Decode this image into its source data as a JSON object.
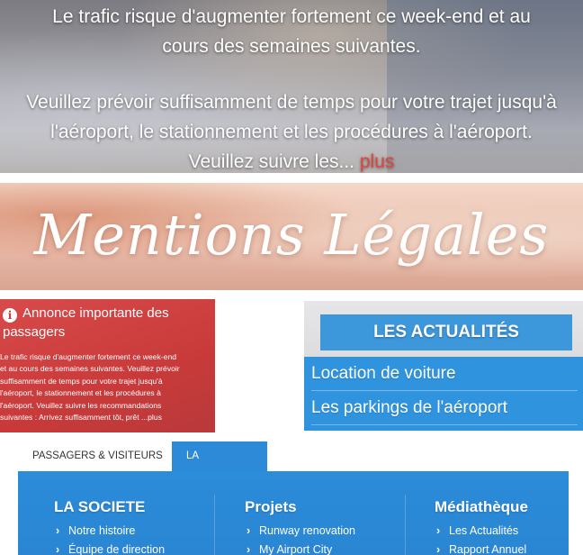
{
  "hero": {
    "line1": "Le trafic risque d'augmenter fortement ce week-end et au",
    "line2": "cours des semaines suivantes.",
    "line3": "Veuillez prévoir suffisamment de temps pour votre trajet jusqu'à",
    "line4": "l'aéroport, le stationnement et les procédures à l'aéroport.",
    "line5": "Veuillez suivre les...",
    "more_link": "plus"
  },
  "mentions": {
    "title": "Mentions Légales"
  },
  "notice": {
    "title_line1": "Annonce importante des",
    "title_line2": "passagers",
    "body": [
      "Le trafic risque d'augmenter fortement ce week-end",
      "et au cours des semaines suivantes. Veuillez prévoir",
      "suffisamment de temps pour votre trajet jusqu'à",
      "l'aéroport, le stationnement et les procédures à",
      "l'aéroport. Veuillez suivre les recommandations",
      "suivantes : Arrivez suffisamment tôt, prêt ...plus"
    ]
  },
  "news": {
    "title": "LES ACTUALITÉS",
    "items": [
      "Location de voiture",
      "Les parkings de l'aéroport"
    ]
  },
  "nav": {
    "tabs": [
      "PASSAGERS & VISITEURS",
      "LA SOCIETE"
    ],
    "chevron": "⌄",
    "columns": [
      {
        "title": "LA SOCIETE",
        "links": [
          "Notre histoire",
          "Équipe de direction"
        ]
      },
      {
        "title": "Projets",
        "links": [
          "Runway renovation",
          "My Airport City"
        ]
      },
      {
        "title": "Médiathèque",
        "links": [
          "Les Actualités",
          "Rapport Annuel"
        ]
      }
    ]
  },
  "colors": {
    "accent_blue": "#2c8ad8",
    "alert_red": "#c93a3a",
    "link_red": "#e0443a"
  }
}
